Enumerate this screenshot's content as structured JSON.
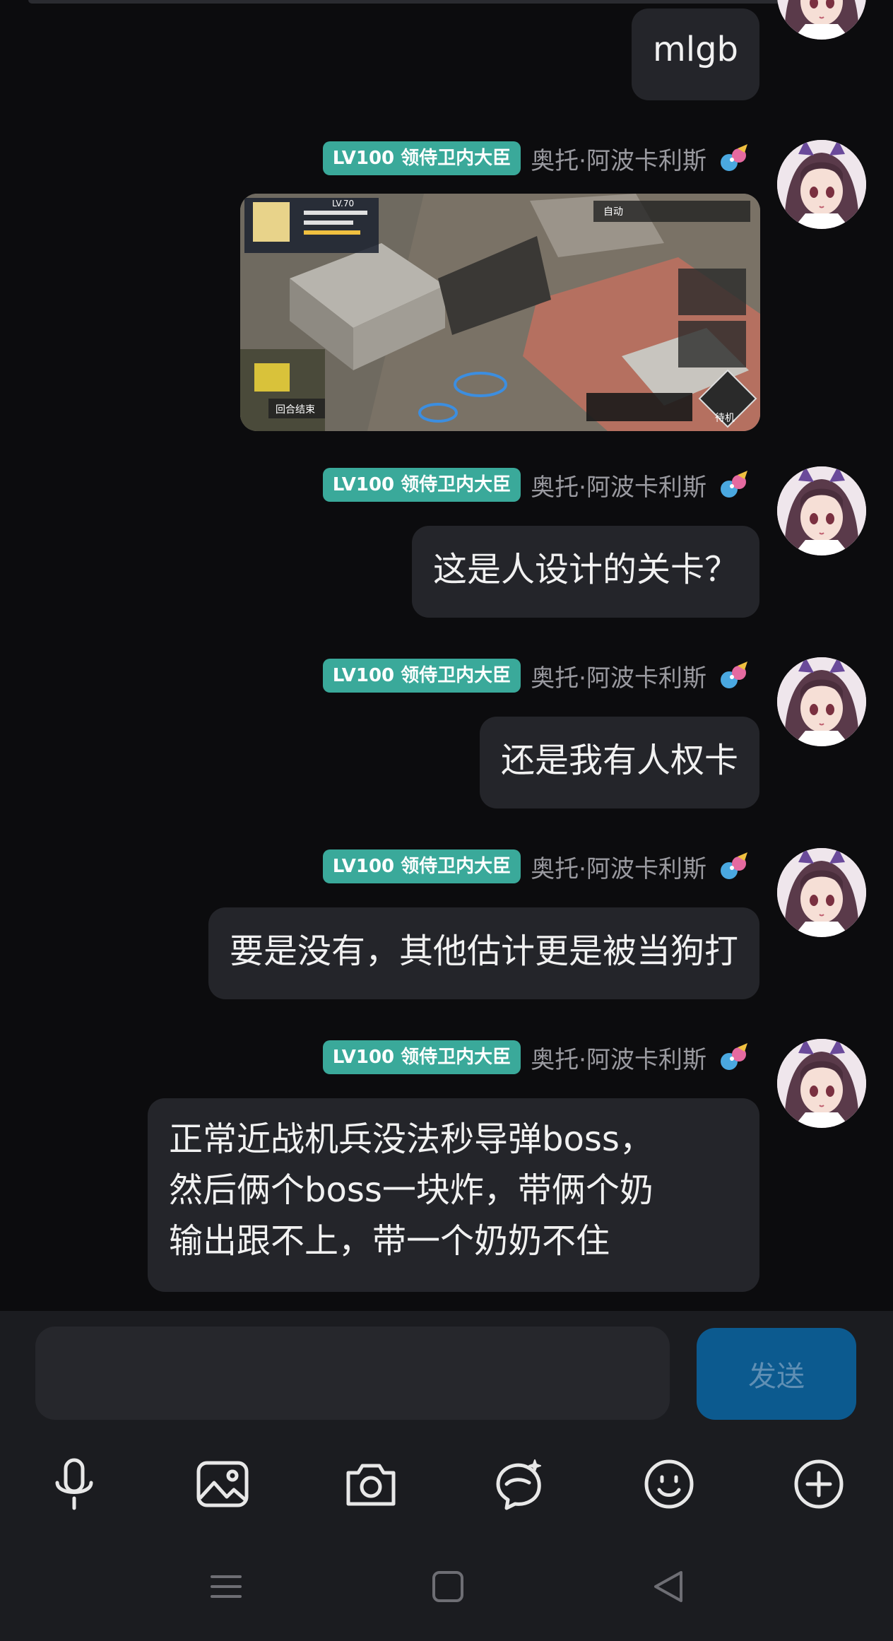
{
  "chat": {
    "messages": [
      {
        "type": "text",
        "text": "mlgb"
      },
      {
        "type": "image",
        "badge": "LV100 领侍卫内大臣",
        "nick": "奥托·阿波卡利斯",
        "game_text": {
          "level": "LV.70",
          "auto": "自动",
          "end_turn": "回合结束",
          "standby": "待机"
        }
      },
      {
        "type": "text",
        "badge": "LV100 领侍卫内大臣",
        "nick": "奥托·阿波卡利斯",
        "text": "这是人设计的关卡？"
      },
      {
        "type": "text",
        "badge": "LV100 领侍卫内大臣",
        "nick": "奥托·阿波卡利斯",
        "text": "还是我有人权卡"
      },
      {
        "type": "text",
        "badge": "LV100 领侍卫内大臣",
        "nick": "奥托·阿波卡利斯",
        "text": "要是没有，其他估计更是被当狗打"
      },
      {
        "type": "text",
        "badge": "LV100 领侍卫内大臣",
        "nick": "奥托·阿波卡利斯",
        "text": "正常近战机兵没法秒导弹boss，\n然后俩个boss一块炸，带俩个奶\n输出跟不上，带一个奶奶不住"
      }
    ]
  },
  "composer": {
    "input_value": "",
    "send_label": "发送",
    "tools": [
      "microphone-icon",
      "image-icon",
      "camera-icon",
      "ai-assistant-icon",
      "emoji-icon",
      "plus-icon"
    ]
  },
  "colors": {
    "background": "#0c0c0e",
    "bubble": "#24252a",
    "badge": "#3aa99a",
    "send_button": "#0c5a8f",
    "composer": "#1b1c20"
  },
  "nav_icons": [
    "menu-icon",
    "home-icon",
    "back-icon"
  ]
}
